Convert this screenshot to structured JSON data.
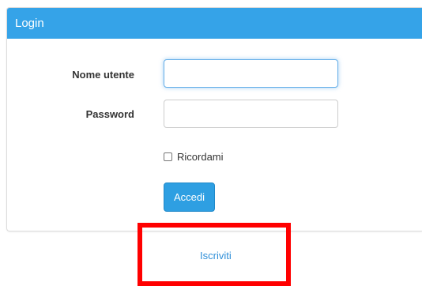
{
  "login_panel": {
    "title": "Login",
    "username_label": "Nome utente",
    "username_value": "",
    "password_label": "Password",
    "password_value": "",
    "remember_label": "Ricordami",
    "remember_checked": false,
    "submit_label": "Accedi"
  },
  "register": {
    "link_label": "Iscriviti"
  },
  "colors": {
    "header_blue": "#35a3e8",
    "button_blue": "#2e9fe2",
    "link_blue": "#2f8fd8",
    "highlight_red": "#ff0000"
  }
}
